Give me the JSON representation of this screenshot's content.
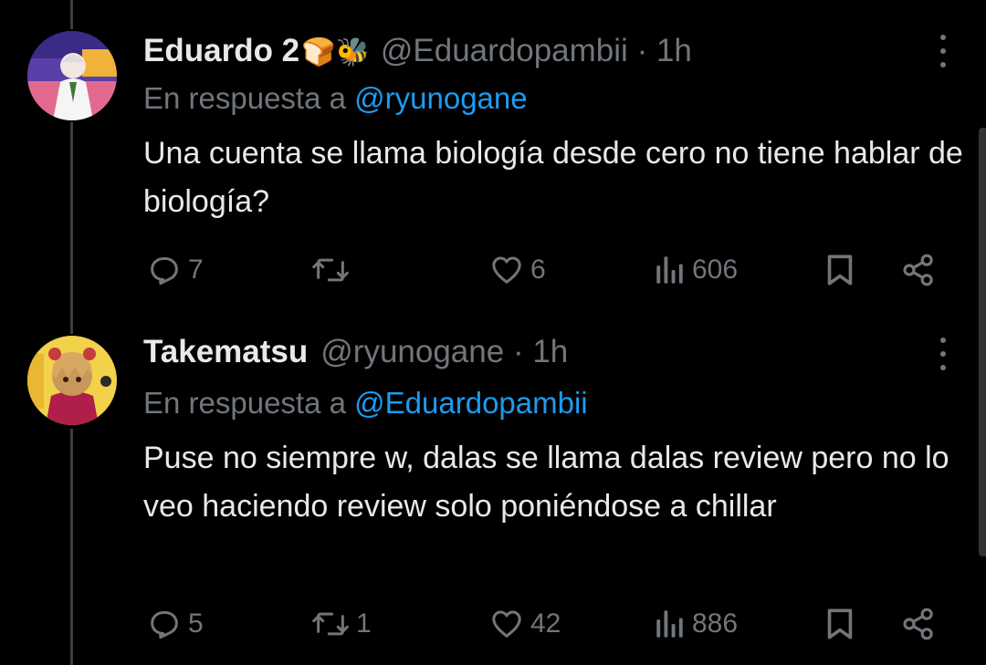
{
  "tweets": [
    {
      "name": "Eduardo 2",
      "emoji": "🍞🐝",
      "handle": "@Eduardopambii",
      "dot": "·",
      "time": "1h",
      "reply_prefix": "En respuesta a",
      "reply_mention": "@ryunogane",
      "text": "Una cuenta se llama biología desde cero no tiene hablar de biología?",
      "replies": "7",
      "retweets": "",
      "likes": "6",
      "views": "606"
    },
    {
      "name": "Takematsu",
      "emoji": "",
      "handle": "@ryunogane",
      "dot": "·",
      "time": "1h",
      "reply_prefix": "En respuesta a",
      "reply_mention": "@Eduardopambii",
      "text": "Puse no siempre w, dalas se llama dalas review pero no lo veo haciendo review solo poniéndose a chillar",
      "replies": "5",
      "retweets": "1",
      "likes": "42",
      "views": "886"
    }
  ],
  "icons": {
    "reply": "reply-icon",
    "retweet": "retweet-icon",
    "like": "heart-icon",
    "views": "views-icon",
    "bookmark": "bookmark-icon",
    "share": "share-icon",
    "more": "more-options-icon"
  },
  "colors": {
    "background": "#000000",
    "text": "#e7e9ea",
    "muted": "#71767b",
    "link": "#1d9bf0"
  }
}
